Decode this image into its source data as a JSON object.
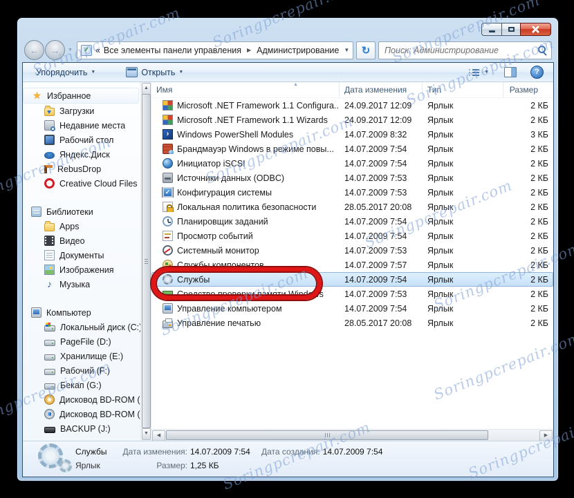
{
  "watermark": {
    "text": "Soringpcrepair.com"
  },
  "icons": {
    "back": "←",
    "forward": "→",
    "dropdown": "▼",
    "small_caret": "▼",
    "chevrons": "«",
    "crumb_sep": "▶",
    "refresh": "↻",
    "help": "?",
    "scroll_up": "▲",
    "scroll_down": "▼",
    "scroll_left": "◀",
    "scroll_right": "▶",
    "sort": "▲",
    "addr_check": "✓"
  },
  "icon_glyphs": {
    "star": "★",
    "music": "♪",
    "powershell": "›",
    "sysconfig": "✓"
  },
  "nav": {
    "address": {
      "chevrons": "«",
      "root": "Все элементы панели управления",
      "current": "Администрирование"
    },
    "search_placeholder": "Поиск: Администрирование"
  },
  "toolbar": {
    "organize_label": "Упорядочить",
    "open_label": "Открыть"
  },
  "list": {
    "columns": [
      "Имя",
      "Дата изменения",
      "Тип",
      "Размер"
    ],
    "rows": [
      {
        "icon": "net",
        "name": "Microsoft .NET Framework 1.1 Configura...",
        "modified": "24.09.2017 12:09",
        "type": "Ярлык",
        "size": "2 КБ"
      },
      {
        "icon": "net",
        "name": "Microsoft .NET Framework 1.1 Wizards",
        "modified": "24.09.2017 12:09",
        "type": "Ярлык",
        "size": "2 КБ"
      },
      {
        "icon": "powershell",
        "name": "Windows PowerShell Modules",
        "modified": "14.07.2009 8:32",
        "type": "Ярлык",
        "size": "3 КБ"
      },
      {
        "icon": "firewall",
        "name": "Брандмауэр Windows в режиме повы...",
        "modified": "14.07.2009 7:54",
        "type": "Ярлык",
        "size": "2 КБ"
      },
      {
        "icon": "globe",
        "name": "Инициатор iSCSI",
        "modified": "14.07.2009 7:54",
        "type": "Ярлык",
        "size": "2 КБ"
      },
      {
        "icon": "odbc",
        "name": "Источники данных (ODBC)",
        "modified": "14.07.2009 7:53",
        "type": "Ярлык",
        "size": "2 КБ"
      },
      {
        "icon": "sysconfig",
        "name": "Конфигурация системы",
        "modified": "14.07.2009 7:53",
        "type": "Ярлык",
        "size": "2 КБ"
      },
      {
        "icon": "lock",
        "name": "Локальная политика безопасности",
        "modified": "28.05.2017 20:08",
        "type": "Ярлык",
        "size": "2 КБ"
      },
      {
        "icon": "clock",
        "name": "Планировщик заданий",
        "modified": "14.07.2009 7:54",
        "type": "Ярлык",
        "size": "2 КБ"
      },
      {
        "icon": "eventlog",
        "name": "Просмотр событий",
        "modified": "14.07.2009 7:54",
        "type": "Ярлык",
        "size": "2 КБ"
      },
      {
        "icon": "perfmon",
        "name": "Системный монитор",
        "modified": "14.07.2009 7:53",
        "type": "Ярлык",
        "size": "2 КБ"
      },
      {
        "icon": "components",
        "name": "Службы компонентов",
        "modified": "14.07.2009 7:57",
        "type": "Ярлык",
        "size": "2 КБ"
      },
      {
        "icon": "gear",
        "name": "Службы",
        "modified": "14.07.2009 7:54",
        "type": "Ярлык",
        "size": "2 КБ",
        "selected": true
      },
      {
        "icon": "memory",
        "name": "Средство проверки памяти Windows",
        "modified": "14.07.2009 7:53",
        "type": "Ярлык",
        "size": "2 КБ"
      },
      {
        "icon": "compmgmt",
        "name": "Управление компьютером",
        "modified": "14.07.2009 7:54",
        "type": "Ярлык",
        "size": "2 КБ"
      },
      {
        "icon": "printer",
        "name": "Управление печатью",
        "modified": "28.05.2017 20:08",
        "type": "Ярлык",
        "size": "2 КБ"
      }
    ]
  },
  "sidebar": {
    "sections": [
      {
        "label": "Избранное",
        "icon": "star",
        "highlight": true,
        "items": [
          {
            "label": "Загрузки",
            "icon": "folder-download"
          },
          {
            "label": "Недавние места",
            "icon": "recent"
          },
          {
            "label": "Рабочий стол",
            "icon": "desktop"
          },
          {
            "label": "Яндекс.Диск",
            "icon": "yandex"
          },
          {
            "label": "RebusDrop",
            "icon": "rebusdrop"
          },
          {
            "label": "Creative Cloud Files",
            "icon": "creative"
          }
        ]
      },
      {
        "label": "Библиотеки",
        "icon": "libraries",
        "items": [
          {
            "label": "Apps",
            "icon": "folder"
          },
          {
            "label": "Видео",
            "icon": "video"
          },
          {
            "label": "Документы",
            "icon": "document"
          },
          {
            "label": "Изображения",
            "icon": "pictures"
          },
          {
            "label": "Музыка",
            "icon": "music"
          }
        ]
      },
      {
        "label": "Компьютер",
        "icon": "computer",
        "items": [
          {
            "label": "Локальный диск (C:)",
            "icon": "drive-system"
          },
          {
            "label": "PageFile (D:)",
            "icon": "drive"
          },
          {
            "label": "Хранилище (E:)",
            "icon": "drive"
          },
          {
            "label": "Рабочий (F:)",
            "icon": "drive"
          },
          {
            "label": "Бекап (G:)",
            "icon": "drive"
          },
          {
            "label": "Дисковод BD-ROM (H:)",
            "icon": "disc-orange"
          },
          {
            "label": "Дисковод BD-ROM (I:)",
            "icon": "disc-blue"
          },
          {
            "label": "BACKUP (J:)",
            "icon": "drive-dark"
          },
          {
            "label": "",
            "icon": "drive"
          }
        ]
      }
    ]
  },
  "details": {
    "name": "Службы",
    "type": "Ярлык",
    "modified_label": "Дата изменения:",
    "modified_value": "14.07.2009 7:54",
    "size_label": "Размер:",
    "size_value": "1,25 КБ",
    "created_label": "Дата создания:",
    "created_value": "14.07.2009 7:54"
  },
  "colors": {
    "frame_glass": "#b9d2ea",
    "selection_fill": "#cfe4f7",
    "selection_border": "#8fb3db",
    "highlight_oval": "#e01515",
    "toolbar_text": "#1e3a5f"
  }
}
